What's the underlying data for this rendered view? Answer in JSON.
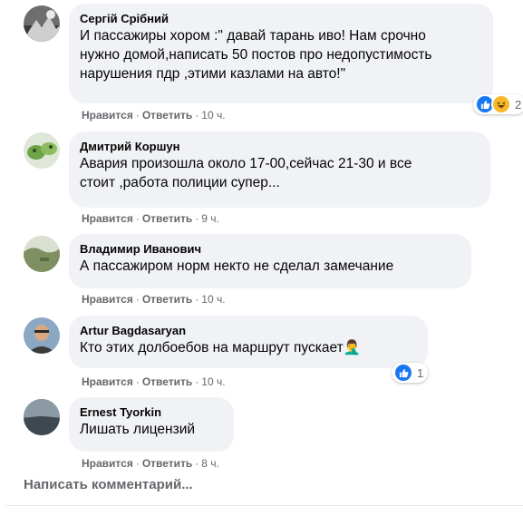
{
  "comments": [
    {
      "author": "Сергій Срібний",
      "text_lines": [
        "И пассажиры хором :\" давай тарань иво! Нам срочно",
        "нужно домой,написать 50 постов про недопустимость",
        "нарушения пдр ,этими казлами на авто!\""
      ],
      "like_label": "Нравится",
      "reply_label": "Ответить",
      "time": "10 ч.",
      "reactions": {
        "icons": [
          "like-icon",
          "haha-icon"
        ],
        "count": "2"
      }
    },
    {
      "author": "Дмитрий Коршун",
      "text_lines": [
        "Авария произошла около 17-00,сейчас 21-30 и все",
        "стоит ,работа полиции супер..."
      ],
      "like_label": "Нравится",
      "reply_label": "Ответить",
      "time": "9 ч."
    },
    {
      "author": "Владимир Иванович",
      "text_lines": [
        "А пассажиром норм некто не сделал замечание"
      ],
      "like_label": "Нравится",
      "reply_label": "Ответить",
      "time": "10 ч."
    },
    {
      "author": "Artur Bagdasaryan",
      "text_lines": [
        "Кто этих долбоебов на маршрут пускает"
      ],
      "emoji": "🤦‍♂️",
      "like_label": "Нравится",
      "reply_label": "Ответить",
      "time": "10 ч.",
      "reactions": {
        "icons": [
          "like-icon"
        ],
        "count": "1"
      }
    },
    {
      "author": "Ernest Tyorkin",
      "text_lines": [
        "Лишать лицензий"
      ],
      "like_label": "Нравится",
      "reply_label": "Ответить",
      "time": "8 ч."
    }
  ],
  "write_comment_placeholder": "Написать комментарий...",
  "colors": {
    "bubble": "#f0f2f5",
    "like_blue": "#1877f2",
    "haha_yellow": "#f7b928",
    "meta_gray": "#65676b"
  }
}
